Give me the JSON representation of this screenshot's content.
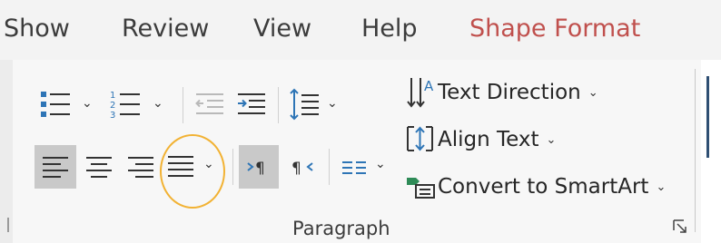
{
  "tabs": [
    {
      "label": "Show",
      "active": false
    },
    {
      "label": "Review",
      "active": false
    },
    {
      "label": "View",
      "active": false
    },
    {
      "label": "Help",
      "active": false
    },
    {
      "label": "Shape Format",
      "active": true
    }
  ],
  "paragraph_group": {
    "label": "Paragraph",
    "buttons": {
      "bullets": {
        "icon": "bulleted-list-icon",
        "has_dropdown": true
      },
      "numbering": {
        "icon": "numbered-list-icon",
        "has_dropdown": true
      },
      "decrease_indent": {
        "icon": "decrease-indent-icon",
        "enabled": false
      },
      "increase_indent": {
        "icon": "increase-indent-icon"
      },
      "line_spacing": {
        "icon": "line-spacing-icon",
        "has_dropdown": true
      },
      "align_left": {
        "icon": "align-left-icon",
        "pressed": true
      },
      "center": {
        "icon": "align-center-icon"
      },
      "align_right": {
        "icon": "align-right-icon"
      },
      "justify": {
        "icon": "justify-icon",
        "has_dropdown": true,
        "highlighted": true
      },
      "ltr": {
        "icon": "left-to-right-icon",
        "pressed": true
      },
      "rtl": {
        "icon": "right-to-left-icon"
      },
      "columns": {
        "icon": "columns-icon",
        "has_dropdown": true
      }
    },
    "text_commands": [
      {
        "key": "text_direction",
        "label": "Text Direction",
        "icon": "text-direction-icon"
      },
      {
        "key": "align_text",
        "label": "Align Text",
        "icon": "align-text-icon"
      },
      {
        "key": "convert_smartart",
        "label": "Convert to SmartArt",
        "icon": "smartart-icon"
      }
    ]
  },
  "colors": {
    "accent_tab": "#c0504d",
    "icon_blue": "#2e75b6",
    "pressed_bg": "#c9c9c9",
    "highlight": "#f2b233"
  },
  "glyphs": {
    "chevron": "⌄"
  }
}
